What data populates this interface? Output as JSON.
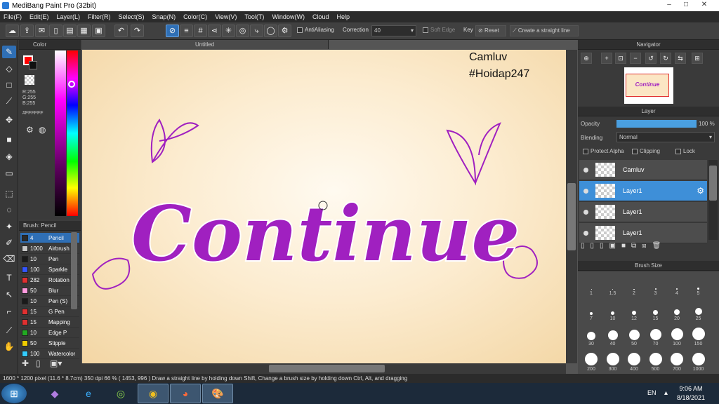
{
  "window": {
    "title": "MediBang Paint Pro (32bit)",
    "min": "–",
    "max": "□",
    "close": "✕"
  },
  "menu": [
    "File(F)",
    "Edit(E)",
    "Layer(L)",
    "Filter(R)",
    "Select(S)",
    "Snap(N)",
    "Color(C)",
    "View(V)",
    "Tool(T)",
    "Window(W)",
    "Cloud",
    "Help"
  ],
  "toolbar": {
    "antialias_label": "AntiAliasing",
    "correction_label": "Correction",
    "correction_value": "40",
    "soft_edge_label": "Soft Edge",
    "key_label": "Key",
    "reset_label": "Reset",
    "straight_line_label": "Create a straight line"
  },
  "document": {
    "tab": "Untitled",
    "watermark1": "Camluv",
    "watermark2": "#Hoidap247",
    "artwork_text": "Continue"
  },
  "color_panel": {
    "title": "Color",
    "r": "R:255",
    "g": "G:255",
    "b": "B:255",
    "hex": "#FFFFFF",
    "primary": "#ff0000",
    "secondary": "#ffffff"
  },
  "brush_panel": {
    "title": "Brush: Pencil",
    "items": [
      {
        "size": "4",
        "name": "Pencil",
        "color": "#2a2a2a",
        "selected": true
      },
      {
        "size": "1000",
        "name": "Airbrush",
        "color": "#c8c8c8"
      },
      {
        "size": "10",
        "name": "Pen",
        "color": "#1a1a1a"
      },
      {
        "size": "100",
        "name": "Sparkle",
        "color": "#3355ff"
      },
      {
        "size": "282",
        "name": "Rotation",
        "color": "#e03030"
      },
      {
        "size": "50",
        "name": "Blur",
        "color": "#ff99dd"
      },
      {
        "size": "10",
        "name": "Pen (S)",
        "color": "#1a1a1a"
      },
      {
        "size": "15",
        "name": "G Pen",
        "color": "#e03030"
      },
      {
        "size": "15",
        "name": "Mapping",
        "color": "#e03030"
      },
      {
        "size": "10",
        "name": "Edge P",
        "color": "#22aa22"
      },
      {
        "size": "50",
        "name": "Stipple",
        "color": "#eecc00"
      },
      {
        "size": "100",
        "name": "Watercolor",
        "color": "#33ccff"
      }
    ]
  },
  "navigator": {
    "title": "Navigator"
  },
  "layer_panel": {
    "title": "Layer",
    "opacity_label": "Opacity",
    "opacity_value": "100 %",
    "opacity_fraction": 1.0,
    "blending_label": "Blending",
    "blending_value": "Normal",
    "protect_alpha": "Protect Alpha",
    "clipping": "Clipping",
    "lock": "Lock",
    "layers": [
      {
        "name": "Camluv",
        "selected": false
      },
      {
        "name": "Layer1",
        "selected": true
      },
      {
        "name": "Layer1",
        "selected": false
      },
      {
        "name": "Layer1",
        "selected": false
      }
    ]
  },
  "brush_size_panel": {
    "title": "Brush Size",
    "sizes": [
      "1",
      "1.5",
      "2",
      "3",
      "4",
      "5",
      "7",
      "10",
      "12",
      "15",
      "20",
      "25",
      "30",
      "40",
      "50",
      "70",
      "100",
      "150",
      "200",
      "300",
      "400",
      "500",
      "700",
      "1000"
    ]
  },
  "status": {
    "text": "1600 * 1200 pixel   (11.6 * 8.7cm)   350 dpi   66 %   ( 1453, 996 )   Draw a straight line by holding down Shift, Change a brush size by holding down Ctrl, Alt, and dragging"
  },
  "taskbar": {
    "lang": "EN",
    "time": "9:06 AM",
    "date": "8/18/2021"
  }
}
